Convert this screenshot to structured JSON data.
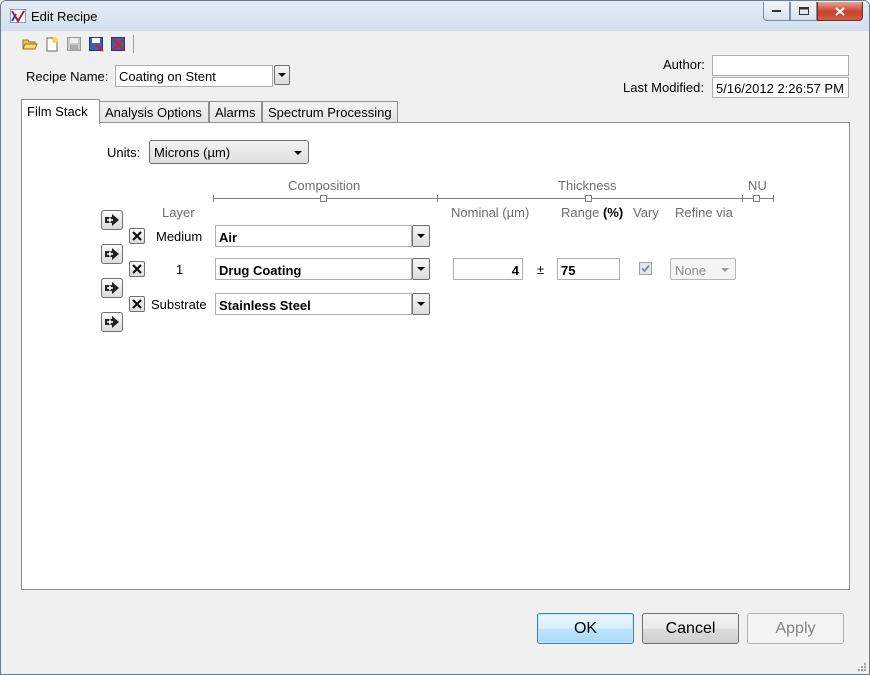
{
  "window": {
    "title": "Edit Recipe"
  },
  "toolbar": {
    "icons": [
      "open-folder-icon",
      "new-recipe-icon",
      "save-icon",
      "save-as-icon",
      "delete-recipe-icon"
    ]
  },
  "recipe": {
    "name_label": "Recipe Name:",
    "name_value": "Coating on Stent"
  },
  "author": {
    "label": "Author:",
    "value": ""
  },
  "last_modified": {
    "label": "Last Modified:",
    "value": "5/16/2012 2:26:57 PM"
  },
  "tabs": [
    {
      "label": "Film Stack",
      "active": true
    },
    {
      "label": "Analysis Options",
      "active": false
    },
    {
      "label": "Alarms",
      "active": false
    },
    {
      "label": "Spectrum Processing",
      "active": false
    }
  ],
  "film_stack": {
    "units_label": "Units:",
    "units_value": "Microns (µm)",
    "headers": {
      "composition": "Composition",
      "thickness": "Thickness",
      "nu": "NU",
      "layer": "Layer",
      "nominal": "Nominal (µm)",
      "range": "Range",
      "range_unit": "(%)",
      "vary": "Vary",
      "refine_via": "Refine via"
    },
    "layers": [
      {
        "name": "Medium",
        "material": "Air"
      },
      {
        "name": "1",
        "material": "Drug Coating",
        "nominal": "4",
        "plusminus": "±",
        "range": "75",
        "vary": true,
        "refine_via": "None"
      },
      {
        "name": "Substrate",
        "material": "Stainless Steel"
      }
    ]
  },
  "buttons": {
    "ok": "OK",
    "cancel": "Cancel",
    "apply": "Apply"
  },
  "colors": {
    "accent_blue": "#3c7fb1",
    "close_red": "#c7402b"
  }
}
